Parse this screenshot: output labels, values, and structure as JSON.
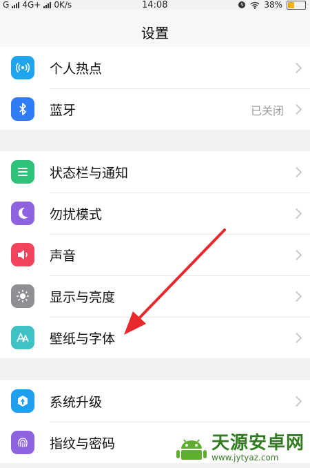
{
  "status": {
    "carrier": "G",
    "network": "4G+",
    "speed": "0K/s",
    "time": "14:08",
    "battery": "38%",
    "battery_level": 0.38
  },
  "header": {
    "title": "设置"
  },
  "groups": [
    {
      "items": [
        {
          "label": "个人热点",
          "icon": "hotspot-icon",
          "color": "#1fa4ee"
        },
        {
          "label": "蓝牙",
          "value": "已关闭",
          "icon": "bluetooth-icon",
          "color": "#2f7cf6"
        }
      ]
    },
    {
      "items": [
        {
          "label": "状态栏与通知",
          "icon": "notification-icon",
          "color": "#2fc27a"
        },
        {
          "label": "勿扰模式",
          "icon": "moon-icon",
          "color": "#8e63e0"
        },
        {
          "label": "声音",
          "icon": "speaker-icon",
          "color": "#f2445c"
        },
        {
          "label": "显示与亮度",
          "icon": "sun-icon",
          "color": "#8e8e93"
        },
        {
          "label": "壁纸与字体",
          "icon": "font-icon",
          "color": "#3fc1c6"
        }
      ]
    },
    {
      "items": [
        {
          "label": "系统升级",
          "icon": "upgrade-icon",
          "color": "#1f9ff0"
        },
        {
          "label": "指纹与密码",
          "icon": "fingerprint-icon",
          "color": "#8e63e0"
        }
      ]
    }
  ],
  "watermark": {
    "name": "天源安卓网",
    "url": "www.jytyaz.com"
  },
  "annotation": {
    "color": "#e8282d"
  }
}
